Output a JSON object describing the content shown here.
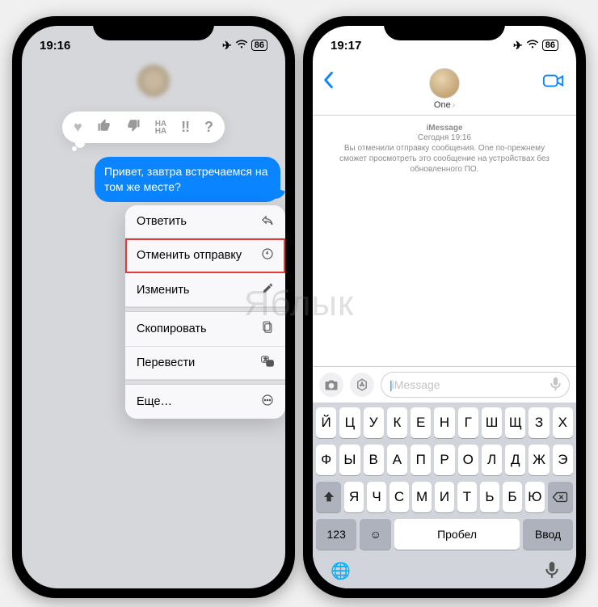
{
  "watermark": "Яблык",
  "left": {
    "time": "19:16",
    "battery": "86",
    "tapbacks": [
      "♥",
      "👍",
      "👎",
      "HA HA",
      "‼︎",
      "?"
    ],
    "bubble_text": "Привет, завтра встречаемся на том же месте?",
    "menu": {
      "reply": "Ответить",
      "undo_send": "Отменить отправку",
      "edit": "Изменить",
      "copy": "Скопировать",
      "translate": "Перевести",
      "more": "Еще…"
    }
  },
  "right": {
    "time": "19:17",
    "battery": "86",
    "contact": "One",
    "sys_line1": "iMessage",
    "sys_line2": "Сегодня 19:16",
    "sys_line3": "Вы отменили отправку сообщения. One по-прежнему сможет просмотреть это сообщение на устройствах без обновленного ПО.",
    "placeholder": "iMessage",
    "kbd": {
      "row1": [
        "Й",
        "Ц",
        "У",
        "К",
        "Е",
        "Н",
        "Г",
        "Ш",
        "Щ",
        "З",
        "Х"
      ],
      "row2": [
        "Ф",
        "Ы",
        "В",
        "А",
        "П",
        "Р",
        "О",
        "Л",
        "Д",
        "Ж",
        "Э"
      ],
      "row3": [
        "Я",
        "Ч",
        "С",
        "М",
        "И",
        "Т",
        "Ь",
        "Б",
        "Ю"
      ],
      "numkey": "123",
      "space": "Пробел",
      "enter": "Ввод"
    }
  }
}
